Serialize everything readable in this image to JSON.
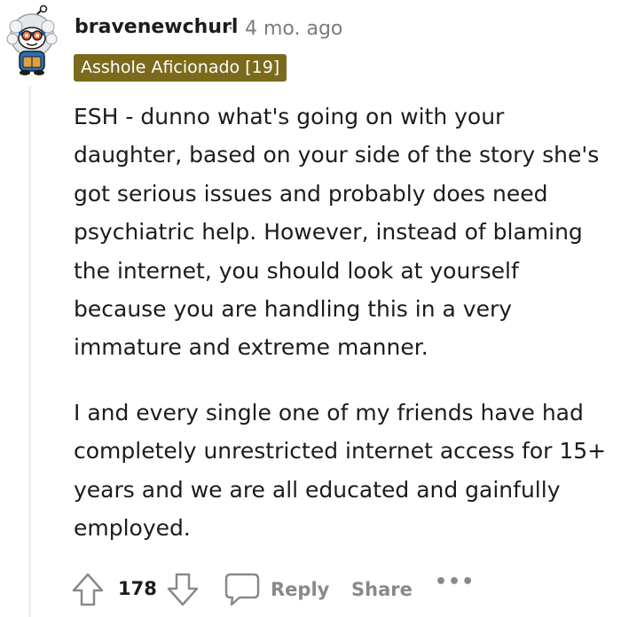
{
  "comment": {
    "username": "bravenewchurl",
    "separator": "·",
    "timestamp": "4 mo. ago",
    "flair": "Asshole Aficionado [19]",
    "flair_color": "#7c6a1c",
    "paragraphs": [
      "ESH - dunno what's going on with your daughter, based on your side of the story she's got serious issues and probably does need psychiatric help. However, instead of blaming the internet, you should look at yourself because you are handling this in a very immature and extreme manner.",
      "I and every single one of my friends have had completely unrestricted internet access for 15+ years and we are all educated and gainfully employed."
    ]
  },
  "actions": {
    "upvote_icon": "upvote-arrow-icon",
    "score": "178",
    "downvote_icon": "downvote-arrow-icon",
    "reply_icon": "speech-bubble-icon",
    "reply_label": "Reply",
    "share_label": "Share",
    "more_label": "•••"
  },
  "colors": {
    "meta_text": "#7c7c7c",
    "action_text": "#878a8c",
    "thread_line": "#edeff1"
  }
}
